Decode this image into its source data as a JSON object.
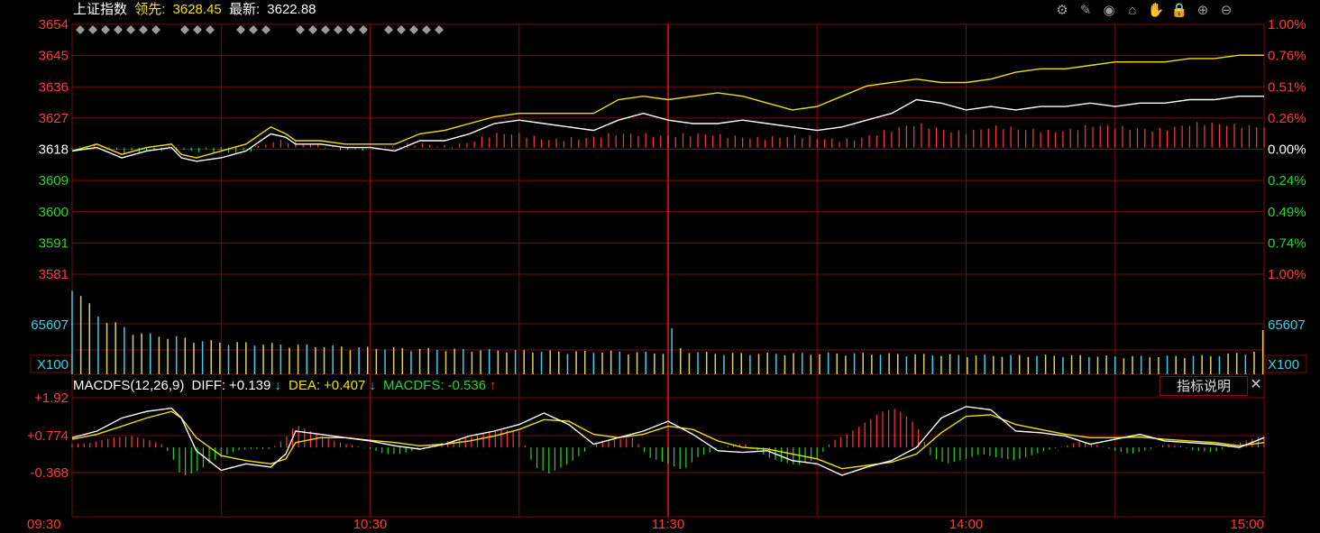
{
  "header": {
    "index_name": "上证指数",
    "lead_label": "领先:",
    "lead_value": "3628.45",
    "latest_label": "最新:",
    "latest_value": "3622.88"
  },
  "toolbar": [
    {
      "name": "settings-gear-icon",
      "glyph": "⚙"
    },
    {
      "name": "pen-draw-icon",
      "glyph": "✎"
    },
    {
      "name": "eye-icon",
      "glyph": "◉"
    },
    {
      "name": "basket-icon",
      "glyph": "⌂"
    },
    {
      "name": "hand-icon",
      "glyph": "✋"
    },
    {
      "name": "lock-icon",
      "glyph": "🔒"
    },
    {
      "name": "zoom-in-icon",
      "glyph": "⊕"
    },
    {
      "name": "zoom-out-icon",
      "glyph": "⊖"
    }
  ],
  "colors": {
    "grid": "#7a0b0b",
    "up": "#ff3a3a",
    "down": "#29d429",
    "price_line": "#ffffff",
    "lead_line": "#f0e000",
    "volume_cyan": "#3ed0e8",
    "volume_yellow": "#e0d060"
  },
  "macd_header": {
    "title": "MACDFS(12,26,9)",
    "diff_label": "DIFF:",
    "diff_value": "+0.139",
    "diff_arrow": "↓",
    "dea_label": "DEA:",
    "dea_value": "+0.407",
    "dea_arrow": "↓",
    "macdfs_label": "MACDFS:",
    "macdfs_value": "-0.536",
    "macdfs_arrow": "↑"
  },
  "explain_button": "指标说明",
  "close_button": "✕",
  "chart_data": {
    "type": "line",
    "price_axis": {
      "left_ticks": [
        "3654",
        "3645",
        "3636",
        "3627",
        "3618",
        "3609",
        "3600",
        "3591",
        "3581"
      ],
      "right_ticks": [
        "1.00%",
        "0.76%",
        "0.51%",
        "0.26%",
        "0.00%",
        "0.24%",
        "0.49%",
        "0.74%",
        "1.00%"
      ],
      "ylim": [
        3581,
        3654
      ],
      "base": 3618
    },
    "volume_axis": {
      "left_ticks": [
        "65607",
        "X100"
      ],
      "right_ticks": [
        "65607",
        "X100"
      ]
    },
    "macd_axis": {
      "ticks": [
        "+1.92",
        "+0.774",
        "-0.368"
      ],
      "ylim": [
        -0.9,
        1.92
      ]
    },
    "x_ticks": [
      "09:30",
      "10:30",
      "11:30",
      "14:00",
      "15:00"
    ],
    "x_minutes_range": [
      0,
      240
    ],
    "price_series": {
      "name": "最新",
      "x": [
        0,
        5,
        10,
        15,
        20,
        22,
        25,
        30,
        35,
        40,
        43,
        45,
        50,
        55,
        60,
        65,
        70,
        75,
        80,
        85,
        90,
        95,
        100,
        105,
        110,
        115,
        120,
        125,
        130,
        135,
        140,
        145,
        150,
        155,
        160,
        165,
        170,
        175,
        180,
        185,
        190,
        195,
        200,
        205,
        210,
        215,
        220,
        225,
        230,
        235,
        240
      ],
      "y": [
        3617,
        3618,
        3615,
        3617,
        3618,
        3615,
        3614,
        3615,
        3617,
        3622,
        3621,
        3619,
        3619,
        3618,
        3618,
        3617,
        3620,
        3620,
        3622,
        3625,
        3626,
        3625,
        3624,
        3623,
        3626,
        3628,
        3626,
        3625,
        3625,
        3626,
        3625,
        3624,
        3623,
        3624,
        3626,
        3628,
        3632,
        3631,
        3629,
        3630,
        3629,
        3630,
        3630,
        3631,
        3630,
        3631,
        3631,
        3632,
        3632,
        3633,
        3633
      ]
    },
    "lead_series": {
      "name": "领先",
      "x": [
        0,
        5,
        10,
        15,
        20,
        22,
        25,
        30,
        35,
        40,
        43,
        45,
        50,
        55,
        60,
        65,
        70,
        75,
        80,
        85,
        90,
        95,
        100,
        105,
        110,
        115,
        120,
        125,
        130,
        135,
        140,
        145,
        150,
        155,
        160,
        165,
        170,
        175,
        180,
        185,
        190,
        195,
        200,
        205,
        210,
        215,
        220,
        225,
        230,
        235,
        240
      ],
      "y": [
        3617,
        3619,
        3616,
        3618,
        3619,
        3616,
        3615,
        3617,
        3619,
        3624,
        3622,
        3620,
        3620,
        3619,
        3619,
        3619,
        3622,
        3623,
        3625,
        3627,
        3628,
        3628,
        3628,
        3628,
        3632,
        3633,
        3632,
        3633,
        3634,
        3633,
        3631,
        3629,
        3630,
        3633,
        3636,
        3637,
        3638,
        3637,
        3637,
        3638,
        3640,
        3641,
        3641,
        3642,
        3643,
        3643,
        3643,
        3644,
        3644,
        3645,
        3645
      ]
    },
    "volume_series": {
      "name": "volume",
      "x": [
        0,
        2,
        4,
        6,
        8,
        10,
        15,
        20,
        25,
        30,
        40,
        50,
        60,
        70,
        80,
        90,
        100,
        110,
        115,
        120,
        121,
        122,
        125,
        130,
        140,
        150,
        160,
        170,
        180,
        190,
        200,
        210,
        220,
        230,
        238,
        239,
        240
      ],
      "y": [
        100,
        80,
        70,
        60,
        55,
        50,
        42,
        40,
        36,
        34,
        32,
        30,
        28,
        27,
        26,
        25,
        24,
        24,
        23,
        23,
        55,
        28,
        24,
        22,
        22,
        22,
        22,
        21,
        20,
        20,
        20,
        19,
        19,
        20,
        24,
        30,
        50
      ]
    },
    "macd_series": {
      "diff": {
        "name": "DIFF",
        "x": [
          0,
          5,
          10,
          15,
          20,
          22,
          25,
          30,
          35,
          40,
          43,
          45,
          50,
          55,
          60,
          65,
          70,
          75,
          80,
          85,
          90,
          95,
          100,
          105,
          110,
          115,
          120,
          125,
          130,
          135,
          140,
          145,
          150,
          155,
          160,
          165,
          170,
          175,
          180,
          185,
          190,
          195,
          200,
          205,
          210,
          215,
          220,
          225,
          230,
          235,
          240
        ],
        "y": [
          0.7,
          0.9,
          1.3,
          1.5,
          1.6,
          1.3,
          0.3,
          -0.3,
          -0.1,
          -0.2,
          0.2,
          0.9,
          0.8,
          0.7,
          0.6,
          0.45,
          0.35,
          0.5,
          0.75,
          0.9,
          1.1,
          1.45,
          1.1,
          0.5,
          0.7,
          0.9,
          1.2,
          0.8,
          0.3,
          0.25,
          0.3,
          0.0,
          -0.1,
          -0.45,
          -0.2,
          0.0,
          0.4,
          1.3,
          1.65,
          1.55,
          0.9,
          0.85,
          0.75,
          0.5,
          0.65,
          0.8,
          0.6,
          0.55,
          0.5,
          0.4,
          0.7
        ]
      },
      "dea": {
        "name": "DEA",
        "x": [
          0,
          5,
          10,
          15,
          20,
          22,
          25,
          30,
          35,
          40,
          43,
          45,
          50,
          55,
          60,
          65,
          70,
          75,
          80,
          85,
          90,
          95,
          100,
          105,
          110,
          115,
          120,
          125,
          130,
          135,
          140,
          145,
          150,
          155,
          160,
          165,
          170,
          175,
          180,
          185,
          190,
          195,
          200,
          205,
          210,
          215,
          220,
          225,
          230,
          235,
          240
        ],
        "y": [
          0.65,
          0.8,
          1.05,
          1.3,
          1.5,
          1.3,
          0.7,
          0.15,
          0.0,
          -0.1,
          0.05,
          0.55,
          0.7,
          0.7,
          0.62,
          0.55,
          0.45,
          0.5,
          0.6,
          0.75,
          0.95,
          1.25,
          1.2,
          0.8,
          0.7,
          0.8,
          1.05,
          0.95,
          0.6,
          0.4,
          0.35,
          0.2,
          0.05,
          -0.25,
          -0.15,
          -0.05,
          0.2,
          0.85,
          1.35,
          1.4,
          1.1,
          0.95,
          0.8,
          0.7,
          0.7,
          0.72,
          0.65,
          0.6,
          0.55,
          0.45,
          0.55
        ]
      },
      "macdfs_bars": {
        "name": "MACDFS",
        "x": [
          0,
          4,
          8,
          12,
          15,
          18,
          20,
          22,
          25,
          28,
          30,
          33,
          36,
          40,
          43,
          45,
          48,
          51,
          54,
          57,
          60,
          63,
          66,
          70,
          73,
          76,
          80,
          83,
          86,
          90,
          93,
          96,
          100,
          103,
          106,
          110,
          113,
          116,
          120,
          123,
          126,
          130,
          133,
          136,
          140,
          143,
          146,
          150,
          153,
          156,
          160,
          163,
          166,
          170,
          173,
          176,
          180,
          183,
          186,
          190,
          193,
          196,
          200,
          203,
          206,
          210,
          213,
          216,
          220,
          223,
          226,
          230,
          233,
          236,
          240
        ],
        "y": [
          0.1,
          0.15,
          0.3,
          0.35,
          0.25,
          0.1,
          -0.25,
          -0.9,
          -0.75,
          -0.45,
          -0.3,
          -0.1,
          -0.05,
          -0.05,
          0.3,
          0.7,
          0.5,
          0.3,
          0.15,
          0.05,
          -0.05,
          -0.2,
          -0.2,
          -0.05,
          0.1,
          0.2,
          0.3,
          0.45,
          0.55,
          0.5,
          -0.6,
          -0.8,
          -0.5,
          -0.15,
          0.2,
          0.25,
          0.3,
          -0.3,
          -0.5,
          -0.7,
          -0.3,
          -0.05,
          0.1,
          0.1,
          -0.3,
          -0.45,
          -0.55,
          -0.35,
          0.2,
          0.4,
          0.8,
          1.1,
          1.2,
          0.7,
          -0.3,
          -0.5,
          -0.35,
          -0.2,
          -0.3,
          -0.4,
          -0.25,
          -0.1,
          0.05,
          0.2,
          0.1,
          -0.1,
          -0.2,
          -0.1,
          0.1,
          0.05,
          -0.1,
          -0.15,
          0.05,
          0.2,
          0.35
        ]
      }
    }
  }
}
